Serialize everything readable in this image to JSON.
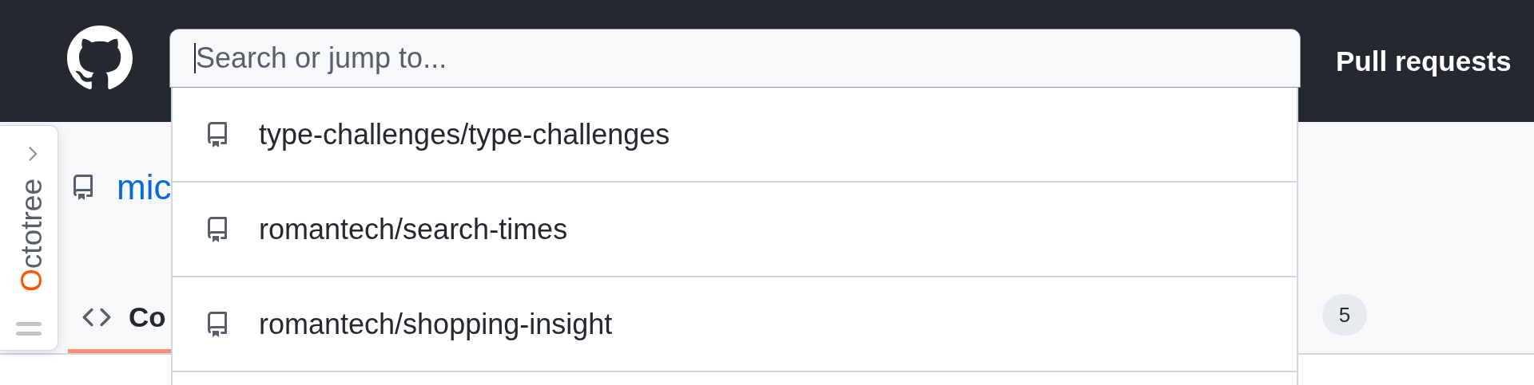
{
  "header": {
    "search": {
      "placeholder": "Search or jump to...",
      "focused": true
    },
    "nav_links": [
      "Pull requests"
    ]
  },
  "search_results": [
    {
      "text": "type-challenges/type-challenges"
    },
    {
      "text": "romantech/search-times"
    },
    {
      "text": "romantech/shopping-insight"
    }
  ],
  "octotree": {
    "label": "Octotree",
    "expanded": false
  },
  "repo": {
    "name": "mic"
  },
  "tabs": [
    {
      "label": "Co",
      "selected": true
    },
    {
      "counter": "5",
      "selected": false
    }
  ]
}
